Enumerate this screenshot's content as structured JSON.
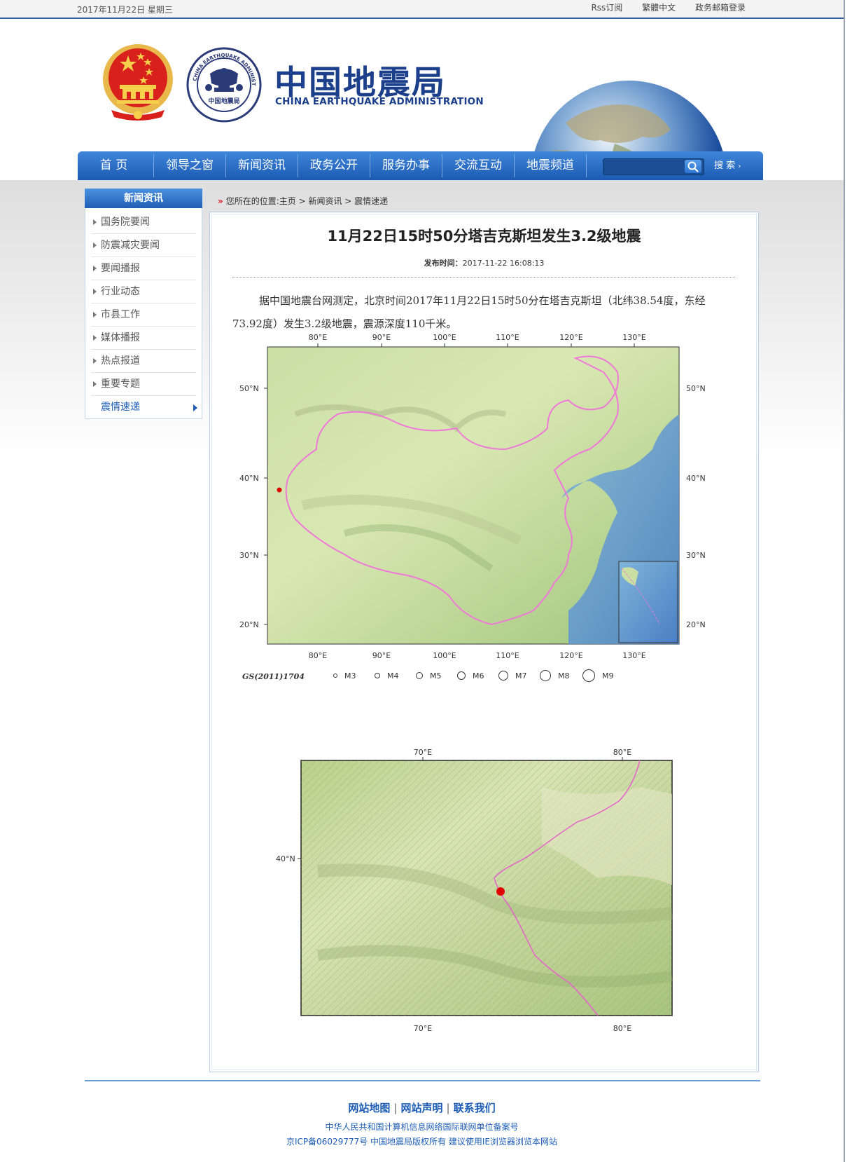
{
  "topbar": {
    "date": "2017年11月22日  星期三",
    "links": [
      "Rss订阅",
      "繁體中文",
      "政务邮箱登录"
    ]
  },
  "header": {
    "logo_cn": "中国地震局",
    "logo_en": "CHINA EARTHQUAKE ADMINISTRATION",
    "seal_text_outer": "CHINA EARTHQUAKE ADMINISTRATION",
    "seal_text_inner": "中国地震局"
  },
  "nav": {
    "items": [
      "首  页",
      "领导之窗",
      "新闻资讯",
      "政务公开",
      "服务办事",
      "交流互动",
      "地震频道"
    ],
    "search_placeholder": "",
    "search_label": "搜  索"
  },
  "sidebar": {
    "heading": "新闻资讯",
    "items": [
      "国务院要闻",
      "防震减灾要闻",
      "要闻播报",
      "行业动态",
      "市县工作",
      "媒体播报",
      "热点报道",
      "重要专题",
      "震情速递"
    ],
    "active_index": 8
  },
  "breadcrumb": "您所在的位置:主页 > 新闻资讯 > 震情速递",
  "article": {
    "title": "11月22日15时50分塔吉克斯坦发生3.2级地震",
    "meta_label": "发布时间：",
    "meta_time": "2017-11-22 16:08:13",
    "body": "据中国地震台网测定，北京时间2017年11月22日15时50分在塔吉克斯坦（北纬38.54度，东经73.92度）发生3.2级地震，震源深度110千米。"
  },
  "map1": {
    "lon_labels": [
      "80°E",
      "90°E",
      "100°E",
      "110°E",
      "120°E",
      "130°E"
    ],
    "lat_labels": [
      "50°N",
      "40°N",
      "30°N",
      "20°N"
    ],
    "credit": "GS(2011)1704",
    "legend": [
      "M3",
      "M4",
      "M5",
      "M6",
      "M7",
      "M8",
      "M9"
    ],
    "epicenter": {
      "lat": 38.54,
      "lon": 73.92
    }
  },
  "map2": {
    "lon_labels": [
      "70°E",
      "80°E"
    ],
    "lat_labels": [
      "40°N"
    ]
  },
  "footer": {
    "links": [
      "网站地图",
      "网站声明",
      "联系我们"
    ],
    "line1": "中华人民共和国计算机信息网络国际联网单位备案号",
    "line2": "京ICP备06029777号  中国地震局版权所有  建议使用IE浏览器浏览本网站"
  },
  "colors": {
    "nav_blue": "#1b5bb3",
    "accent_blue": "#1d5db5",
    "border_pink": "#f078d8",
    "epicenter_red": "#e00000"
  }
}
